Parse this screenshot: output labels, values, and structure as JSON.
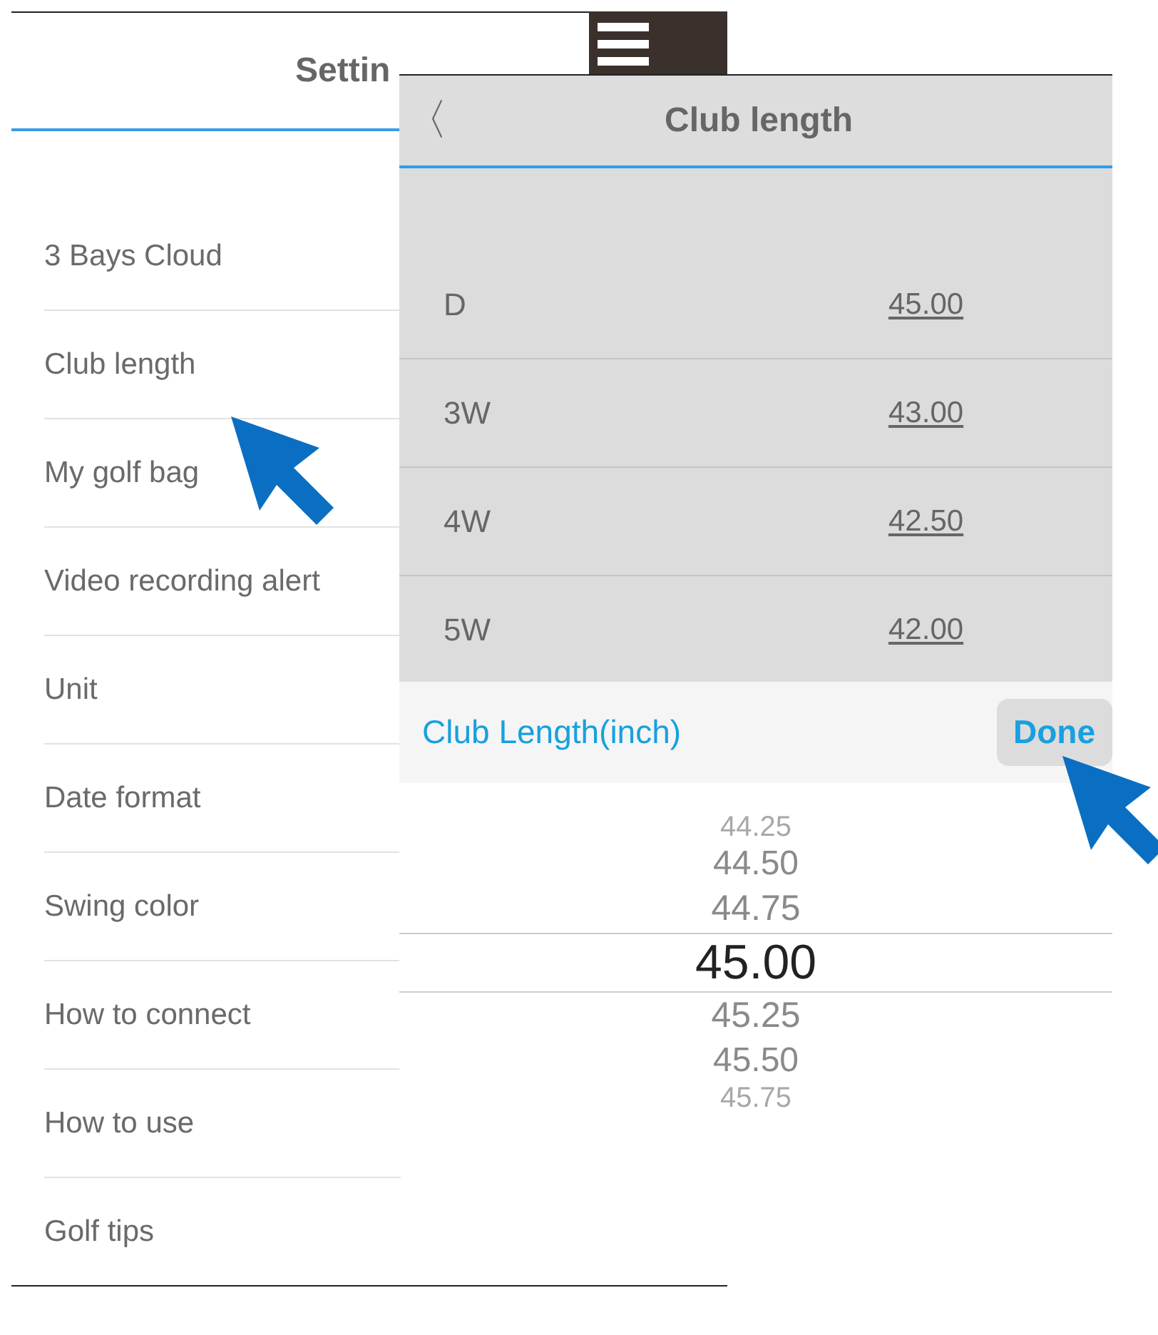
{
  "settings_screen": {
    "title": "Settin",
    "items": [
      {
        "label": "3 Bays Cloud"
      },
      {
        "label": "Club length"
      },
      {
        "label": "My golf bag"
      },
      {
        "label": "Video recording alert"
      },
      {
        "label": "Unit"
      },
      {
        "label": "Date format"
      },
      {
        "label": "Swing color"
      },
      {
        "label": "How to connect"
      },
      {
        "label": "How to use"
      },
      {
        "label": "Golf tips"
      }
    ]
  },
  "club_length_screen": {
    "title": "Club length",
    "back": "〈",
    "rows": [
      {
        "club": "D",
        "length": "45.00"
      },
      {
        "club": "3W",
        "length": "43.00"
      },
      {
        "club": "4W",
        "length": "42.50"
      },
      {
        "club": "5W",
        "length": "42.00"
      }
    ],
    "picker_toolbar": {
      "label": "Club Length(inch)",
      "done": "Done"
    },
    "picker": [
      {
        "value": "44.25",
        "selected": false
      },
      {
        "value": "44.50",
        "selected": false
      },
      {
        "value": "44.75",
        "selected": false
      },
      {
        "value": "45.00",
        "selected": true
      },
      {
        "value": "45.25",
        "selected": false
      },
      {
        "value": "45.50",
        "selected": false
      },
      {
        "value": "45.75",
        "selected": false
      }
    ]
  }
}
